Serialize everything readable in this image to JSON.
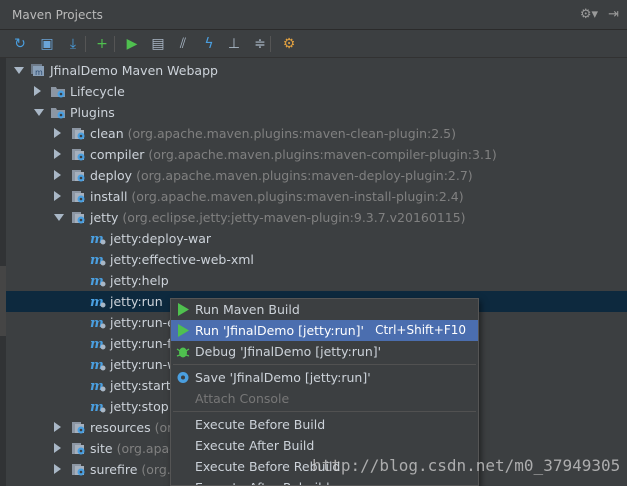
{
  "panel": {
    "title": "Maven Projects",
    "settings_icon": "gear-icon",
    "pin_icon": "hide-panel-icon"
  },
  "toolbar": {
    "buttons": [
      {
        "name": "reimport-icon",
        "glyph": "↻",
        "color": "#4a9fe0"
      },
      {
        "name": "generate-sources-icon",
        "glyph": "▣",
        "color": "#6aa4d8"
      },
      {
        "name": "download-icon",
        "glyph": "⤓",
        "color": "#4a9fe0"
      },
      {
        "name": "add-icon",
        "glyph": "+",
        "color": "#4fc04f"
      },
      {
        "name": "run-icon",
        "glyph": "▶",
        "color": "#4fc04f"
      },
      {
        "name": "maven-goal-icon",
        "glyph": "▤",
        "color": "#a9b7c6"
      },
      {
        "name": "toggle-offline-icon",
        "glyph": "⫽",
        "color": "#a9b7c6"
      },
      {
        "name": "skip-tests-icon",
        "glyph": "ϟ",
        "color": "#4a9fe0"
      },
      {
        "name": "dependencies-icon",
        "glyph": "⊥",
        "color": "#a9b7c6"
      },
      {
        "name": "collapse-all-icon",
        "glyph": "≑",
        "color": "#a9b7c6"
      },
      {
        "name": "settings-icon",
        "glyph": "⚙",
        "color": "#e0a040"
      }
    ]
  },
  "tree": {
    "rows": [
      {
        "name": "project-node",
        "level": 0,
        "expanded": true,
        "icon": "maven-project-icon",
        "label": "JfinalDemo Maven Webapp",
        "detail": ""
      },
      {
        "name": "lifecycle-node",
        "level": 1,
        "expanded": false,
        "icon": "folder-icon",
        "label": "Lifecycle",
        "detail": ""
      },
      {
        "name": "plugins-node",
        "level": 1,
        "expanded": true,
        "icon": "folder-icon",
        "label": "Plugins",
        "detail": ""
      },
      {
        "name": "plugin-clean",
        "level": 2,
        "expanded": false,
        "icon": "plugin-icon",
        "label": "clean",
        "detail": "(org.apache.maven.plugins:maven-clean-plugin:2.5)"
      },
      {
        "name": "plugin-compiler",
        "level": 2,
        "expanded": false,
        "icon": "plugin-icon",
        "label": "compiler",
        "detail": "(org.apache.maven.plugins:maven-compiler-plugin:3.1)"
      },
      {
        "name": "plugin-deploy",
        "level": 2,
        "expanded": false,
        "icon": "plugin-icon",
        "label": "deploy",
        "detail": "(org.apache.maven.plugins:maven-deploy-plugin:2.7)"
      },
      {
        "name": "plugin-install",
        "level": 2,
        "expanded": false,
        "icon": "plugin-icon",
        "label": "install",
        "detail": "(org.apache.maven.plugins:maven-install-plugin:2.4)"
      },
      {
        "name": "plugin-jetty",
        "level": 2,
        "expanded": true,
        "icon": "plugin-icon",
        "label": "jetty",
        "detail": "(org.eclipse.jetty:jetty-maven-plugin:9.3.7.v20160115)"
      },
      {
        "name": "goal-deploy-war",
        "level": 3,
        "leaf": true,
        "icon": "goal-icon",
        "label": "jetty:deploy-war",
        "detail": ""
      },
      {
        "name": "goal-effective-web-xml",
        "level": 3,
        "leaf": true,
        "icon": "goal-icon",
        "label": "jetty:effective-web-xml",
        "detail": ""
      },
      {
        "name": "goal-help",
        "level": 3,
        "leaf": true,
        "icon": "goal-icon",
        "label": "jetty:help",
        "detail": ""
      },
      {
        "name": "goal-run",
        "level": 3,
        "leaf": true,
        "icon": "goal-icon",
        "label": "jetty:run",
        "detail": "",
        "selected": true
      },
      {
        "name": "goal-run-exploded",
        "level": 3,
        "leaf": true,
        "icon": "goal-icon",
        "label": "jetty:run-ex",
        "detail": ""
      },
      {
        "name": "goal-run-forked",
        "level": 3,
        "leaf": true,
        "icon": "goal-icon",
        "label": "jetty:run-fo",
        "detail": ""
      },
      {
        "name": "goal-run-war",
        "level": 3,
        "leaf": true,
        "icon": "goal-icon",
        "label": "jetty:run-w",
        "detail": ""
      },
      {
        "name": "goal-start",
        "level": 3,
        "leaf": true,
        "icon": "goal-icon",
        "label": "jetty:start",
        "detail": ""
      },
      {
        "name": "goal-stop",
        "level": 3,
        "leaf": true,
        "icon": "goal-icon",
        "label": "jetty:stop",
        "detail": ""
      },
      {
        "name": "plugin-resources",
        "level": 2,
        "expanded": false,
        "icon": "plugin-icon",
        "label": "resources",
        "detail": "(org"
      },
      {
        "name": "plugin-site",
        "level": 2,
        "expanded": false,
        "icon": "plugin-icon",
        "label": "site",
        "detail": "(org.apac"
      },
      {
        "name": "plugin-surefire",
        "level": 2,
        "expanded": false,
        "icon": "plugin-icon",
        "label": "surefire",
        "detail": "(org.a"
      }
    ]
  },
  "context_menu": {
    "items": [
      {
        "name": "menu-run-maven-build",
        "label": "Run Maven Build",
        "icon": "run-icon",
        "shortcut": "",
        "disabled": false,
        "highlighted": false
      },
      {
        "name": "menu-run-config",
        "label": "Run 'JfinalDemo [jetty:run]'",
        "icon": "run-icon",
        "shortcut": "Ctrl+Shift+F10",
        "disabled": false,
        "highlighted": true
      },
      {
        "name": "menu-debug-config",
        "label": "Debug 'JfinalDemo [jetty:run]'",
        "icon": "debug-icon",
        "shortcut": "",
        "disabled": false,
        "highlighted": false
      },
      {
        "separator": true
      },
      {
        "name": "menu-save-config",
        "label": "Save 'JfinalDemo [jetty:run]'",
        "icon": "save-config-icon",
        "shortcut": "",
        "disabled": false,
        "highlighted": false
      },
      {
        "name": "menu-attach-console",
        "label": "Attach Console",
        "icon": "",
        "shortcut": "",
        "disabled": true,
        "highlighted": false
      },
      {
        "separator": true
      },
      {
        "name": "menu-execute-before-build",
        "label": "Execute Before Build",
        "icon": "",
        "shortcut": "",
        "disabled": false,
        "highlighted": false
      },
      {
        "name": "menu-execute-after-build",
        "label": "Execute After Build",
        "icon": "",
        "shortcut": "",
        "disabled": false,
        "highlighted": false
      },
      {
        "name": "menu-execute-before-rebuild",
        "label": "Execute Before Rebuild",
        "icon": "",
        "shortcut": "",
        "disabled": false,
        "highlighted": false
      },
      {
        "name": "menu-execute-after-rebuild",
        "label": "Execute After Rebuild",
        "icon": "",
        "shortcut": "",
        "disabled": false,
        "highlighted": false
      }
    ]
  },
  "watermark": "http://blog.csdn.net/m0_37949305"
}
